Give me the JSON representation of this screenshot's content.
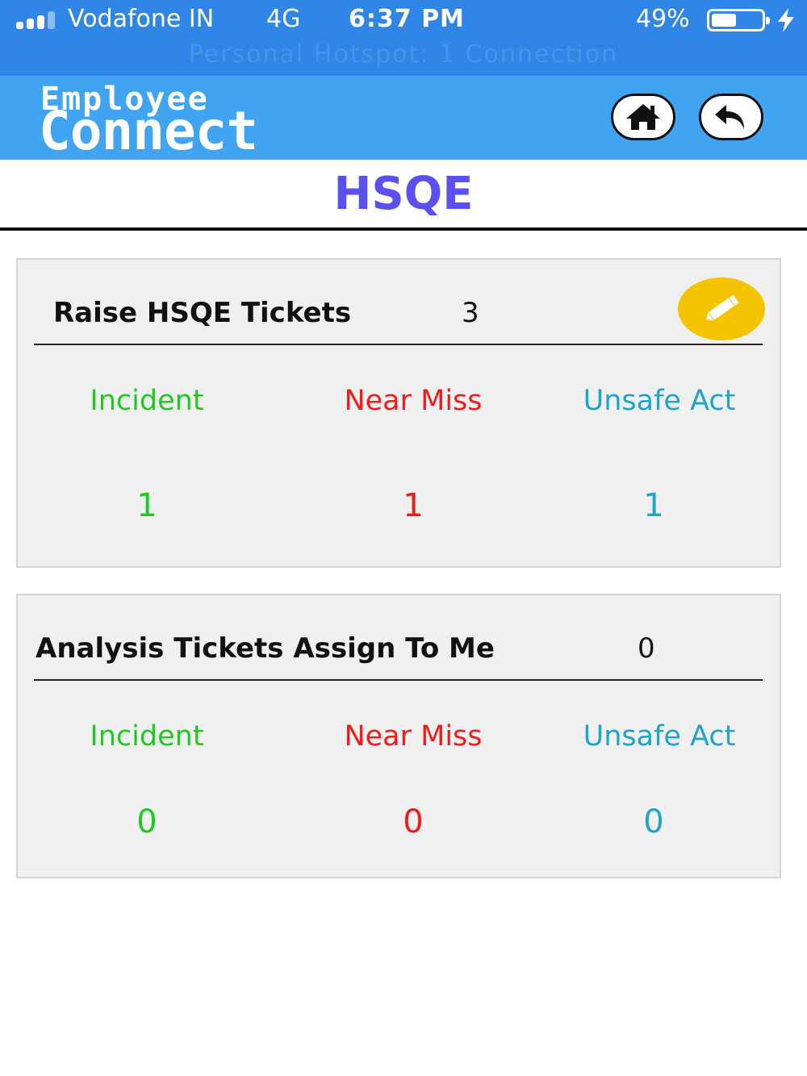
{
  "status_bar": {
    "carrier": "Vodafone IN",
    "network": "4G",
    "time": "6:37 PM",
    "battery_percent": "49%",
    "hotspot": "Personal Hotspot: 1 Connection",
    "signal_bars_filled": 3,
    "signal_bars_total": 4,
    "battery_level": 0.49
  },
  "header": {
    "logo_line1": "Employee",
    "logo_line2": "Connect",
    "home_icon": "home-icon",
    "back_icon": "back-arrow-icon",
    "color": "#40a4f0"
  },
  "page": {
    "title": "HSQE",
    "title_color": "#5a4ff0"
  },
  "raise_tickets": {
    "title": "Raise HSQE Tickets",
    "count": "3",
    "edit_icon": "pencil-icon",
    "categories": [
      {
        "label": "Incident",
        "value": "1",
        "color": "#1fc91f"
      },
      {
        "label": "Near Miss",
        "value": "1",
        "color": "#f01c1c"
      },
      {
        "label": "Unsafe Act",
        "value": "1",
        "color": "#1ca5c8"
      }
    ]
  },
  "analysis_tickets": {
    "title": "Analysis Tickets Assign To Me",
    "count": "0",
    "categories": [
      {
        "label": "Incident",
        "value": "0",
        "color": "#1fc91f"
      },
      {
        "label": "Near Miss",
        "value": "0",
        "color": "#f01c1c"
      },
      {
        "label": "Unsafe Act",
        "value": "0",
        "color": "#1ca5c8"
      }
    ]
  }
}
